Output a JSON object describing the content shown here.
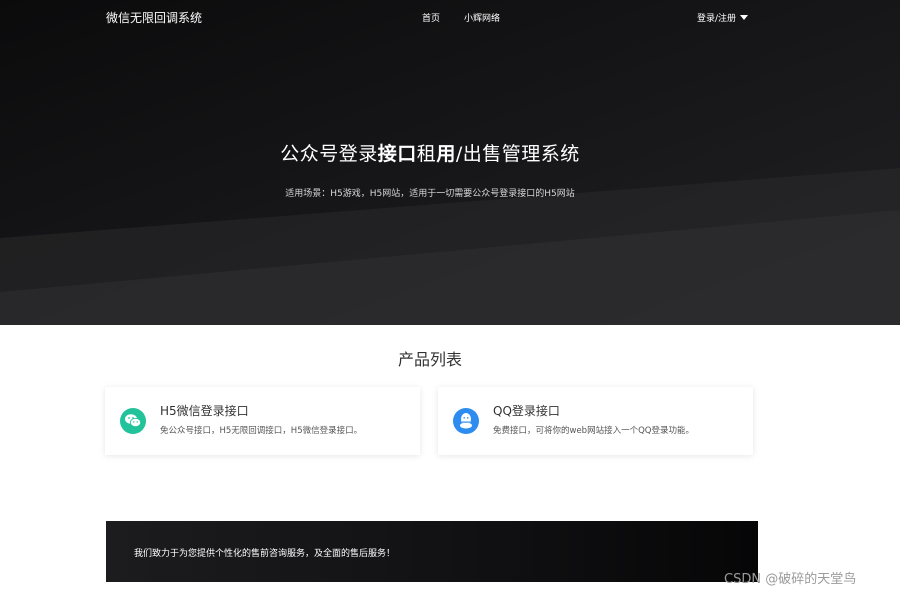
{
  "nav": {
    "brand": "微信无限回调系统",
    "links": [
      "首页",
      "小辉网络"
    ],
    "login_label": "登录/注册"
  },
  "hero": {
    "title_part1": "公众号登录",
    "title_bold1": "接口",
    "title_part2": "租",
    "title_bold2": "用",
    "title_part3": "/出售管理系统",
    "subtitle": "适用场景：H5游戏，H5网站，适用于一切需要公众号登录接口的H5网站"
  },
  "products": {
    "section_title": "产品列表",
    "items": [
      {
        "icon": "wechat-icon",
        "title": "H5微信登录接口",
        "desc": "免公众号接口，H5无限回调接口，H5微信登录接口。"
      },
      {
        "icon": "qq-icon",
        "title": "QQ登录接口",
        "desc": "免费接口，可将你的web网站接入一个QQ登录功能。"
      }
    ]
  },
  "cta": {
    "text": "我们致力于为您提供个性化的售前咨询服务，及全面的售后服务！"
  },
  "watermark": "CSDN @破碎的天堂鸟",
  "colors": {
    "hero_bg": "#141416",
    "wechat_green": "#22c29a",
    "qq_blue": "#2d8cf0"
  }
}
